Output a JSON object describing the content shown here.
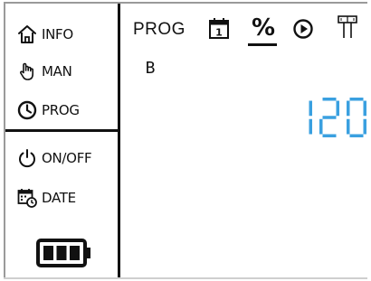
{
  "sidebar": {
    "items": [
      {
        "label": "INFO",
        "icon": "home-icon"
      },
      {
        "label": "MAN",
        "icon": "hand-icon"
      },
      {
        "label": "PROG",
        "icon": "clock-icon"
      },
      {
        "label": "ON/OFF",
        "icon": "power-icon"
      },
      {
        "label": "DATE",
        "icon": "calendar-clock-icon"
      }
    ],
    "battery": {
      "icon": "battery-icon",
      "level": 1.0
    }
  },
  "main": {
    "mode_label": "PROG",
    "tabs": [
      {
        "name": "calendar",
        "icon": "calendar-icon",
        "text": "1"
      },
      {
        "name": "percent",
        "label": "%",
        "selected": true
      },
      {
        "name": "start",
        "icon": "play-icon"
      },
      {
        "name": "valve",
        "icon": "valve-icon"
      }
    ],
    "program": "B",
    "readout": "120",
    "readout_color": "#3aa0e0"
  }
}
